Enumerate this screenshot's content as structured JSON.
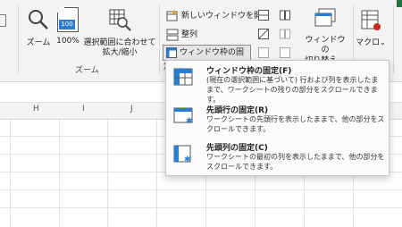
{
  "ribbon": {
    "zoom_group": {
      "label": "ズーム",
      "zoom_button": "ズーム",
      "zoom100_button": "100%",
      "zoom100_icon_text": "100",
      "zoom_selection_line1": "選択範囲に合わせて",
      "zoom_selection_line2": "拡大/縮小"
    },
    "window_group": {
      "new_window": "新しいウィンドウを開く",
      "arrange": "整列",
      "freeze_panes": "ウィンドウ枠の固定",
      "switch_windows_line1": "ウィンドウの",
      "switch_windows_line2": "切り替え",
      "macro": "マクロ"
    }
  },
  "sheet": {
    "columns": [
      "H",
      "I",
      "J"
    ]
  },
  "freeze_menu": {
    "items": [
      {
        "title": "ウィンドウ枠の固定(F)",
        "desc": "(現在の選択範囲に基づいて) 行および列を表示したままで、ワークシートの残りの部分をスクロールできます。"
      },
      {
        "title": "先頭行の固定(R)",
        "desc": "ワークシートの先頭行を表示したままで、他の部分をスクロールできます。"
      },
      {
        "title": "先頭列の固定(C)",
        "desc": "ワークシートの最初の列を表示したままで、他の部分をスクロールできます。"
      }
    ]
  },
  "colors": {
    "accent_blue": "#2b7cd3",
    "ribbon_bg": "#f3f3f3",
    "red_accent": "#c42b1c"
  }
}
